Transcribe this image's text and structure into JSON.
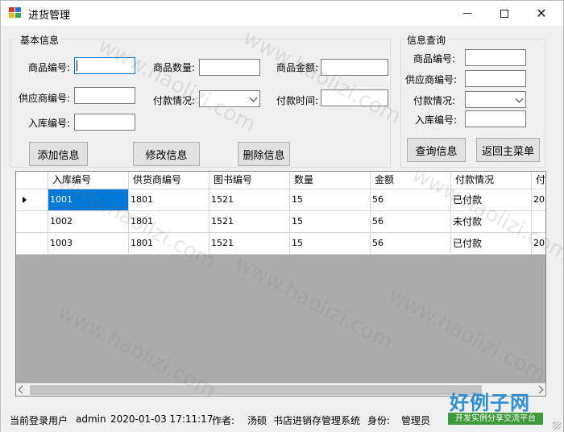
{
  "window": {
    "title": "进货管理"
  },
  "basic_info": {
    "group_title": "基本信息",
    "product_id_label": "商品编号:",
    "product_qty_label": "商品数量:",
    "product_amount_label": "商品金额:",
    "supplier_id_label": "供应商编号:",
    "payment_status_label": "付款情况:",
    "payment_time_label": "付款时间:",
    "stock_in_id_label": "入库编号:",
    "product_id_value": "",
    "product_qty_value": "",
    "product_amount_value": "",
    "supplier_id_value": "",
    "payment_status_value": "",
    "payment_time_value": "",
    "stock_in_id_value": "",
    "add_button": "添加信息",
    "edit_button": "修改信息",
    "delete_button": "删除信息"
  },
  "query": {
    "group_title": "信息查询",
    "product_id_label": "商品编号:",
    "supplier_id_label": "供应商编号:",
    "payment_status_label": "付款情况:",
    "stock_in_id_label": "入库编号:",
    "product_id_value": "",
    "supplier_id_value": "",
    "payment_status_value": "",
    "stock_in_id_value": "",
    "query_button": "查询信息",
    "back_button": "返回主菜单"
  },
  "grid": {
    "columns": [
      "入库编号",
      "供货商编号",
      "图书编号",
      "数量",
      "金额",
      "付款情况",
      "付"
    ],
    "rows": [
      [
        "1001",
        "1801",
        "1521",
        "15",
        "56",
        "已付款",
        "20"
      ],
      [
        "1002",
        "1801",
        "1521",
        "15",
        "56",
        "未付款",
        ""
      ],
      [
        "1003",
        "1801",
        "1521",
        "15",
        "56",
        "已付款",
        "20"
      ]
    ],
    "selected_row": 0
  },
  "statusbar": {
    "user_label": "当前登录用户",
    "user_value": "admin",
    "datetime": "2020-01-03 17:11:17",
    "author_label": "作者:",
    "author_value": "汤硕",
    "system_name": "书店进销存管理系统",
    "role_label": "身份:",
    "role_value": "管理员"
  },
  "watermark": {
    "text": "www.haolizi.com",
    "brand_title": "好例子网",
    "brand_sub": "开发实例分享交流平台"
  },
  "colors": {
    "accent": "#0078d7",
    "grid_background": "#ababab",
    "brand_blue": "#2f8fd6",
    "brand_green": "#3e9a3a"
  }
}
